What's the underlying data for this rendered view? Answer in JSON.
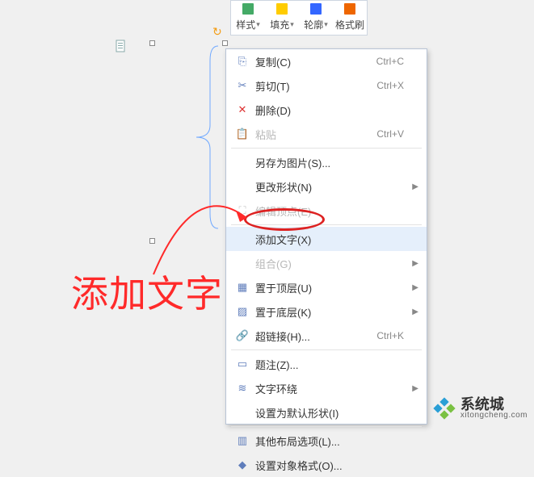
{
  "toolbar": [
    {
      "name": "style",
      "label": "样式",
      "icon": "#4a6",
      "dd": true
    },
    {
      "name": "fill",
      "label": "填充",
      "icon": "#fc0",
      "dd": true
    },
    {
      "name": "outline",
      "label": "轮廓",
      "icon": "#36f",
      "dd": true
    },
    {
      "name": "format-painter",
      "label": "格式刷",
      "icon": "#e60",
      "dd": false
    }
  ],
  "menu": [
    {
      "name": "copy",
      "label": "复制(C)",
      "key": "Ctrl+C",
      "ico": "⎘"
    },
    {
      "name": "cut",
      "label": "剪切(T)",
      "key": "Ctrl+X",
      "ico": "✂"
    },
    {
      "name": "delete",
      "label": "删除(D)",
      "ico": "✕",
      "icoColor": "#d33"
    },
    {
      "name": "paste",
      "label": "粘贴",
      "key": "Ctrl+V",
      "ico": "📋",
      "disabled": true
    },
    {
      "sep": true
    },
    {
      "name": "save-as-image",
      "label": "另存为图片(S)...",
      "indent": true
    },
    {
      "name": "change-shape",
      "label": "更改形状(N)",
      "sub": true,
      "indent": true
    },
    {
      "name": "edit-points",
      "label": "编辑顶点(E)",
      "ico": "⛶",
      "disabled": true
    },
    {
      "sep": true
    },
    {
      "name": "add-text",
      "label": "添加文字(X)",
      "highlight": true,
      "indent": true
    },
    {
      "name": "group",
      "label": "组合(G)",
      "sub": true,
      "disabled": true,
      "indent": true
    },
    {
      "name": "bring-front",
      "label": "置于顶层(U)",
      "ico": "▦",
      "sub": true
    },
    {
      "name": "send-back",
      "label": "置于底层(K)",
      "ico": "▨",
      "sub": true
    },
    {
      "name": "hyperlink",
      "label": "超链接(H)...",
      "ico": "🔗",
      "key": "Ctrl+K"
    },
    {
      "sep": true
    },
    {
      "name": "caption",
      "label": "题注(Z)...",
      "ico": "▭"
    },
    {
      "name": "text-wrap",
      "label": "文字环绕",
      "ico": "≋",
      "sub": true
    },
    {
      "name": "set-default",
      "label": "设置为默认形状(I)",
      "indent": true
    },
    {
      "sep": true
    },
    {
      "name": "more-layout",
      "label": "其他布局选项(L)...",
      "ico": "▥"
    },
    {
      "name": "object-format",
      "label": "设置对象格式(O)...",
      "ico": "◆"
    }
  ],
  "annotation": "添加文字",
  "watermark": {
    "title": "系统城",
    "sub": "xitongcheng.com"
  }
}
